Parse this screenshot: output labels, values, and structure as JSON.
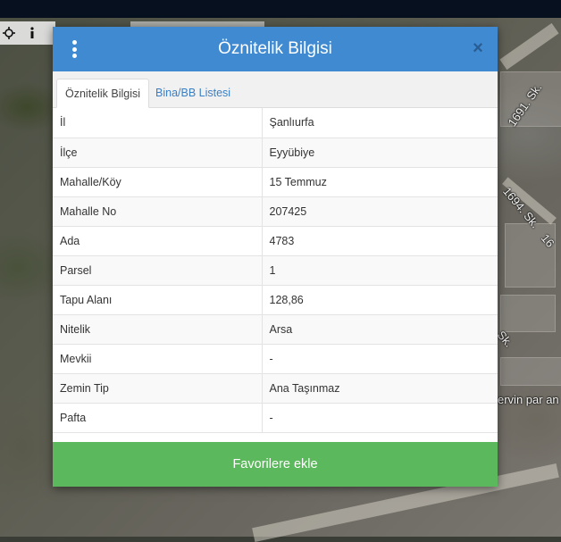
{
  "map": {
    "streets": [
      "1691. Sk.",
      "1694. Sk.",
      "16",
      "Sk.",
      "ervin par an"
    ]
  },
  "toolbar": {
    "icons": [
      "move-icon",
      "info-icon"
    ]
  },
  "modal": {
    "title": "Öznitelik Bilgisi",
    "close_glyph": "×",
    "tabs": [
      {
        "label": "Öznitelik Bilgisi",
        "active": true
      },
      {
        "label": "Bina/BB Listesi",
        "active": false
      }
    ],
    "rows": [
      {
        "key": "İl",
        "value": "Şanlıurfa"
      },
      {
        "key": "İlçe",
        "value": "Eyyübiye"
      },
      {
        "key": "Mahalle/Köy",
        "value": "15 Temmuz"
      },
      {
        "key": "Mahalle No",
        "value": "207425"
      },
      {
        "key": "Ada",
        "value": "4783"
      },
      {
        "key": "Parsel",
        "value": "1"
      },
      {
        "key": "Tapu Alanı",
        "value": "128,86"
      },
      {
        "key": "Nitelik",
        "value": "Arsa"
      },
      {
        "key": "Mevkii",
        "value": "-"
      },
      {
        "key": "Zemin Tip",
        "value": "Ana Taşınmaz"
      },
      {
        "key": "Pafta",
        "value": "-"
      }
    ],
    "favorite_button": "Favorilere ekle"
  },
  "colors": {
    "header": "#3f8ad1",
    "button": "#5cb85c",
    "tab_link": "#3b7fc4",
    "topbar": "#07101e"
  }
}
